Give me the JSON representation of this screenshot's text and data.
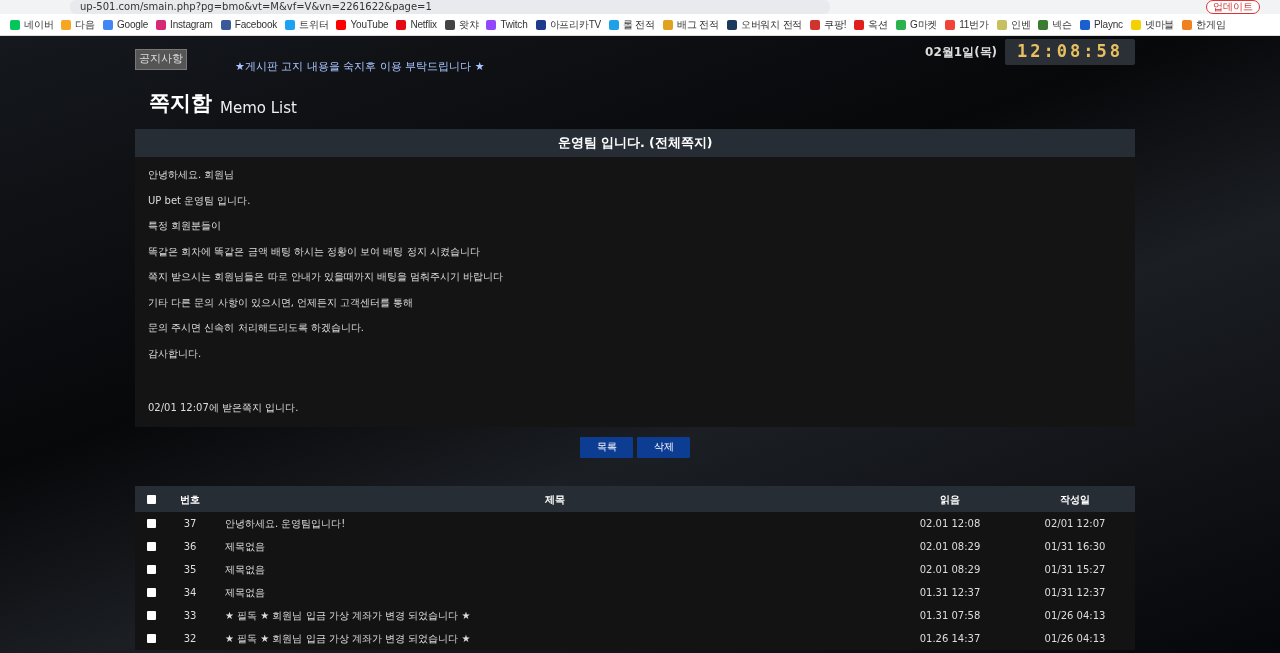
{
  "browser": {
    "address": "up-501.com/smain.php?pg=bmo&vt=M&vf=V&vn=2261622&page=1",
    "update_button": "업데이트",
    "bookmarks": [
      {
        "label": "네이버",
        "color": "#03c75a"
      },
      {
        "label": "다음",
        "color": "#f5a623"
      },
      {
        "label": "Google",
        "color": "#4285f4"
      },
      {
        "label": "Instagram",
        "color": "#d62976"
      },
      {
        "label": "Facebook",
        "color": "#3b5998"
      },
      {
        "label": "트위터",
        "color": "#1da1f2"
      },
      {
        "label": "YouTube",
        "color": "#ff0000"
      },
      {
        "label": "Netflix",
        "color": "#e50914"
      },
      {
        "label": "왓챠",
        "color": "#444444"
      },
      {
        "label": "Twitch",
        "color": "#9146ff"
      },
      {
        "label": "아프리카TV",
        "color": "#1e3a8a"
      },
      {
        "label": "롤 전적",
        "color": "#1ea1e8"
      },
      {
        "label": "배그 전적",
        "color": "#e0a020"
      },
      {
        "label": "오버워치 전적",
        "color": "#1c3a5c"
      },
      {
        "label": "쿠팡!",
        "color": "#d0342c"
      },
      {
        "label": "옥션",
        "color": "#e0201c"
      },
      {
        "label": "G마켓",
        "color": "#2bb24c"
      },
      {
        "label": "11번가",
        "color": "#f04438"
      },
      {
        "label": "인벤",
        "color": "#c8c060"
      },
      {
        "label": "넥슨",
        "color": "#3a7d30"
      },
      {
        "label": "Plaync",
        "color": "#1a5fd0"
      },
      {
        "label": "넷마블",
        "color": "#f5d000"
      },
      {
        "label": "한게임",
        "color": "#f08020"
      }
    ]
  },
  "notice": {
    "label": "공지사항",
    "text": "★게시판 고지 내용을 숙지후 이용 부탁드립니다 ★"
  },
  "clock": {
    "date": "02월1일(목)",
    "time": "12:08:58"
  },
  "page_title": {
    "title": "쪽지함",
    "subtitle": "Memo List"
  },
  "memo": {
    "title": "운영팀 입니다. (전체쪽지)",
    "lines": [
      "안녕하세요. 회원님",
      "UP bet 운영팀 입니다.",
      "특정 회원분들이",
      "똑같은 회차에 똑같은 금액 배팅 하시는 정황이 보여 배팅 정지 시켰습니다",
      "쪽지 받으시는 회원님들은 따로 안내가 있을때까지 배팅을 멈춰주시기 바랍니다",
      "기타 다른 문의 사항이 있으시면, 언제든지 고객센터를 통해",
      "문의 주시면 신속히 처리해드리도록 하겠습니다.",
      "감사합니다."
    ],
    "received": "02/01 12:07에 받은쪽지 입니다."
  },
  "buttons": [
    "목록",
    "삭제"
  ],
  "table": {
    "select_all": false,
    "columns": [
      "번호",
      "제목",
      "읽음",
      "작성일"
    ],
    "rows": [
      {
        "checked": false,
        "cells": [
          "37",
          "안녕하세요. 운영팀입니다!",
          "02.01 12:08",
          "02/01 12:07"
        ]
      },
      {
        "checked": false,
        "cells": [
          "36",
          "제목없음",
          "02.01 08:29",
          "01/31 16:30"
        ]
      },
      {
        "checked": false,
        "cells": [
          "35",
          "제목없음",
          "02.01 08:29",
          "01/31 15:27"
        ]
      },
      {
        "checked": false,
        "cells": [
          "34",
          "제목없음",
          "01.31 12:37",
          "01/31 12:37"
        ]
      },
      {
        "checked": false,
        "cells": [
          "33",
          "★ 필독 ★ 회원님 입금 가상 계좌가 변경 되었습니다 ★",
          "01.31 07:58",
          "01/26 04:13"
        ]
      },
      {
        "checked": false,
        "cells": [
          "32",
          "★ 필독 ★ 회원님 입금 가상 계좌가 변경 되었습니다 ★",
          "01.26 14:37",
          "01/26 04:13"
        ]
      }
    ]
  }
}
